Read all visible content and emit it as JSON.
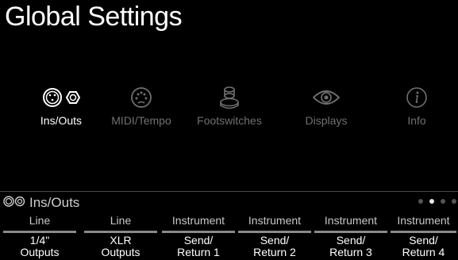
{
  "header": {
    "title": "Global Settings"
  },
  "menu": {
    "items": [
      {
        "label": "Ins/Outs",
        "icon": "ins-outs-icon",
        "active": true
      },
      {
        "label": "MIDI/Tempo",
        "icon": "midi-icon",
        "active": false
      },
      {
        "label": "Footswitches",
        "icon": "footswitch-icon",
        "active": false
      },
      {
        "label": "Displays",
        "icon": "eye-icon",
        "active": false
      },
      {
        "label": "Info",
        "icon": "info-icon",
        "active": false
      }
    ]
  },
  "panel": {
    "title": "Ins/Outs",
    "icon": "ins-outs-icon",
    "page_indicator": {
      "pages": 4,
      "current": 2
    }
  },
  "params": [
    {
      "value": "Line",
      "label_line1": "1/4\"",
      "label_line2": "Outputs"
    },
    {
      "value": "Line",
      "label_line1": "XLR",
      "label_line2": "Outputs"
    },
    {
      "value": "Instrument",
      "label_line1": "Send/",
      "label_line2": "Return 1"
    },
    {
      "value": "Instrument",
      "label_line1": "Send/",
      "label_line2": "Return 2"
    },
    {
      "value": "Instrument",
      "label_line1": "Send/",
      "label_line2": "Return 3"
    },
    {
      "value": "Instrument",
      "label_line1": "Send/",
      "label_line2": "Return 4"
    }
  ],
  "colors": {
    "background": "#000000",
    "active": "#ffffff",
    "inactive": "#707070",
    "value_text": "#c8c8c8"
  }
}
